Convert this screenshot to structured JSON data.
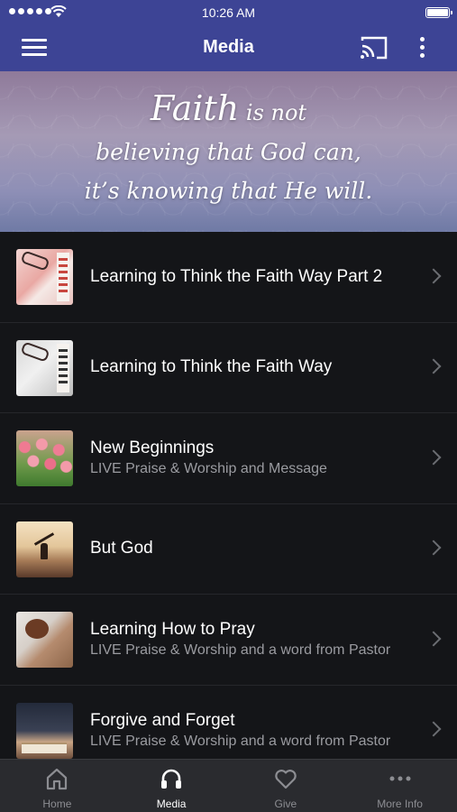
{
  "status_bar": {
    "time": "10:26 AM"
  },
  "nav": {
    "title": "Media"
  },
  "banner": {
    "quote_big": "Faith",
    "quote_line1_rest": " is not",
    "quote_line2": "believing that God can,",
    "quote_line3": "it’s knowing that He will."
  },
  "media_items": [
    {
      "title": "Learning to Think the Faith Way Part 2",
      "subtitle": ""
    },
    {
      "title": "Learning to Think the Faith Way",
      "subtitle": ""
    },
    {
      "title": "New Beginnings",
      "subtitle": "LIVE Praise & Worship and Message"
    },
    {
      "title": "But God",
      "subtitle": ""
    },
    {
      "title": "Learning How to Pray",
      "subtitle": "LIVE Praise & Worship and a word from Pastor"
    },
    {
      "title": "Forgive and Forget",
      "subtitle": "LIVE Praise & Worship and a word from Pastor"
    }
  ],
  "tabs": [
    {
      "label": "Home",
      "icon": "home-icon",
      "active": false
    },
    {
      "label": "Media",
      "icon": "headphones-icon",
      "active": true
    },
    {
      "label": "Give",
      "icon": "heart-icon",
      "active": false
    },
    {
      "label": "More Info",
      "icon": "more-dots-icon",
      "active": false
    }
  ],
  "colors": {
    "nav_bar": "#3d4495",
    "list_background": "#141518",
    "tab_bar": "#2a2b2f",
    "subtitle_text": "#9a9ba0"
  }
}
